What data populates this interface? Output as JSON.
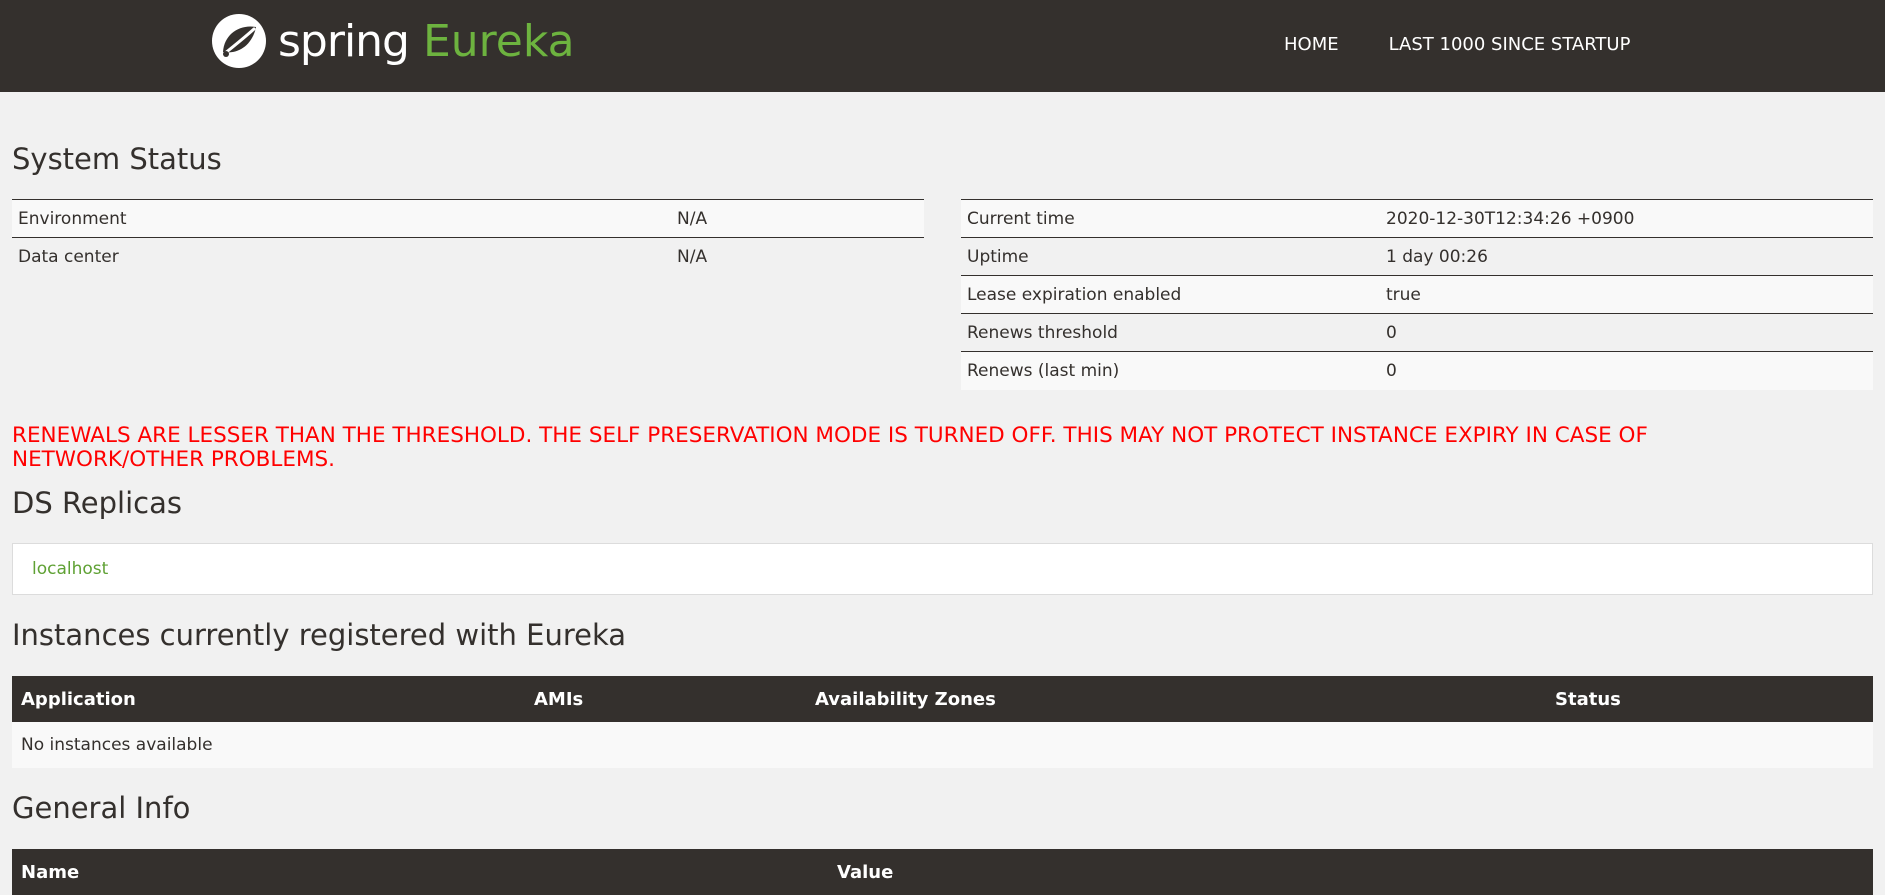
{
  "brand": {
    "name_part1": "spring",
    "name_part2": "Eureka"
  },
  "nav": {
    "home": "HOME",
    "last1000": "LAST 1000 SINCE STARTUP"
  },
  "system_status": {
    "title": "System Status",
    "left": [
      {
        "label": "Environment",
        "value": "N/A"
      },
      {
        "label": "Data center",
        "value": "N/A"
      }
    ],
    "right": [
      {
        "label": "Current time",
        "value": "2020-12-30T12:34:26 +0900"
      },
      {
        "label": "Uptime",
        "value": "1 day 00:26"
      },
      {
        "label": "Lease expiration enabled",
        "value": "true"
      },
      {
        "label": "Renews threshold",
        "value": "0"
      },
      {
        "label": "Renews (last min)",
        "value": "0"
      }
    ]
  },
  "warning": "RENEWALS ARE LESSER THAN THE THRESHOLD. THE SELF PRESERVATION MODE IS TURNED OFF. THIS MAY NOT PROTECT INSTANCE EXPIRY IN CASE OF NETWORK/OTHER PROBLEMS.",
  "ds_replicas": {
    "title": "DS Replicas",
    "items": [
      "localhost"
    ]
  },
  "instances": {
    "title": "Instances currently registered with Eureka",
    "headers": [
      "Application",
      "AMIs",
      "Availability Zones",
      "Status"
    ],
    "empty_message": "No instances available"
  },
  "general_info": {
    "title": "General Info",
    "headers": [
      "Name",
      "Value"
    ]
  },
  "colors": {
    "header_bg": "#34302d",
    "brand_green": "#6db33f",
    "warning_red": "#ff0000",
    "link_green": "#5fa134"
  }
}
